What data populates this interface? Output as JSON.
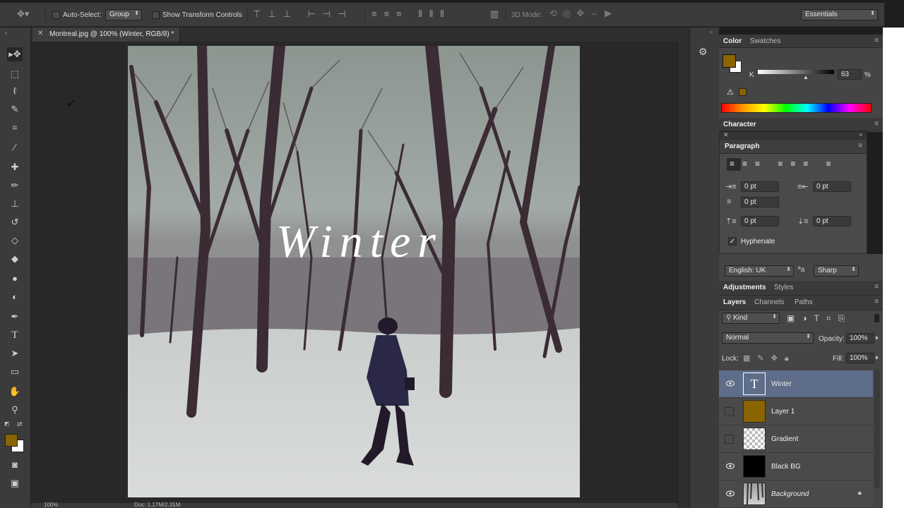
{
  "options_bar": {
    "auto_select_label": "Auto-Select:",
    "auto_select_value": "Group",
    "show_transform_label": "Show Transform Controls",
    "mode_3d_label": "3D Mode:",
    "workspace": "Essentials"
  },
  "document": {
    "tab_title": "Montreal.jpg @ 100% (Winter, RGB/8) *",
    "canvas_text": "Winter"
  },
  "status_bar": {
    "zoom": "100%",
    "doc_size": "Doc: 1.17M/2.31M"
  },
  "tools": [
    "move-tool",
    "marquee-tool",
    "lasso-tool",
    "quick-select-tool",
    "crop-tool",
    "eyedropper-tool",
    "healing-brush-tool",
    "brush-tool",
    "clone-stamp-tool",
    "history-brush-tool",
    "eraser-tool",
    "paint-bucket-tool",
    "blur-tool",
    "dodge-tool",
    "pen-tool",
    "type-tool",
    "path-select-tool",
    "rectangle-tool",
    "hand-tool",
    "zoom-tool"
  ],
  "colors": {
    "foreground": "#8a6400",
    "background": "#ffffff",
    "selection": "#5e6d89"
  },
  "color_panel": {
    "tabs": [
      "Color",
      "Swatches"
    ],
    "k_label": "K",
    "k_value": "63",
    "k_unit": "%"
  },
  "character_panel": {
    "title": "Character"
  },
  "paragraph_panel": {
    "title": "Paragraph",
    "indent_left": "0 pt",
    "indent_right": "0 pt",
    "indent_first": "0 pt",
    "space_before": "0 pt",
    "space_after": "0 pt",
    "hyphenate_label": "Hyphenate"
  },
  "language_row": {
    "language": "English: UK",
    "aa_label": "a",
    "antialias": "Sharp"
  },
  "adjustments_panel": {
    "tabs": [
      "Adjustments",
      "Styles"
    ]
  },
  "layers_panel": {
    "tabs": [
      "Layers",
      "Channels",
      "Paths"
    ],
    "filter_kind": "Kind",
    "blend_mode": "Normal",
    "opacity_label": "Opacity:",
    "opacity_value": "100%",
    "lock_label": "Lock:",
    "fill_label": "Fill:",
    "fill_value": "100%",
    "layers": [
      {
        "name": "Winter",
        "type": "text",
        "visible": true,
        "selected": true
      },
      {
        "name": "Layer 1",
        "type": "fill",
        "visible": false,
        "selected": false
      },
      {
        "name": "Gradient",
        "type": "transparent",
        "visible": false,
        "selected": false
      },
      {
        "name": "Black BG",
        "type": "black",
        "visible": true,
        "selected": false
      },
      {
        "name": "Background",
        "type": "photo",
        "visible": true,
        "selected": false,
        "locked": true
      }
    ]
  }
}
